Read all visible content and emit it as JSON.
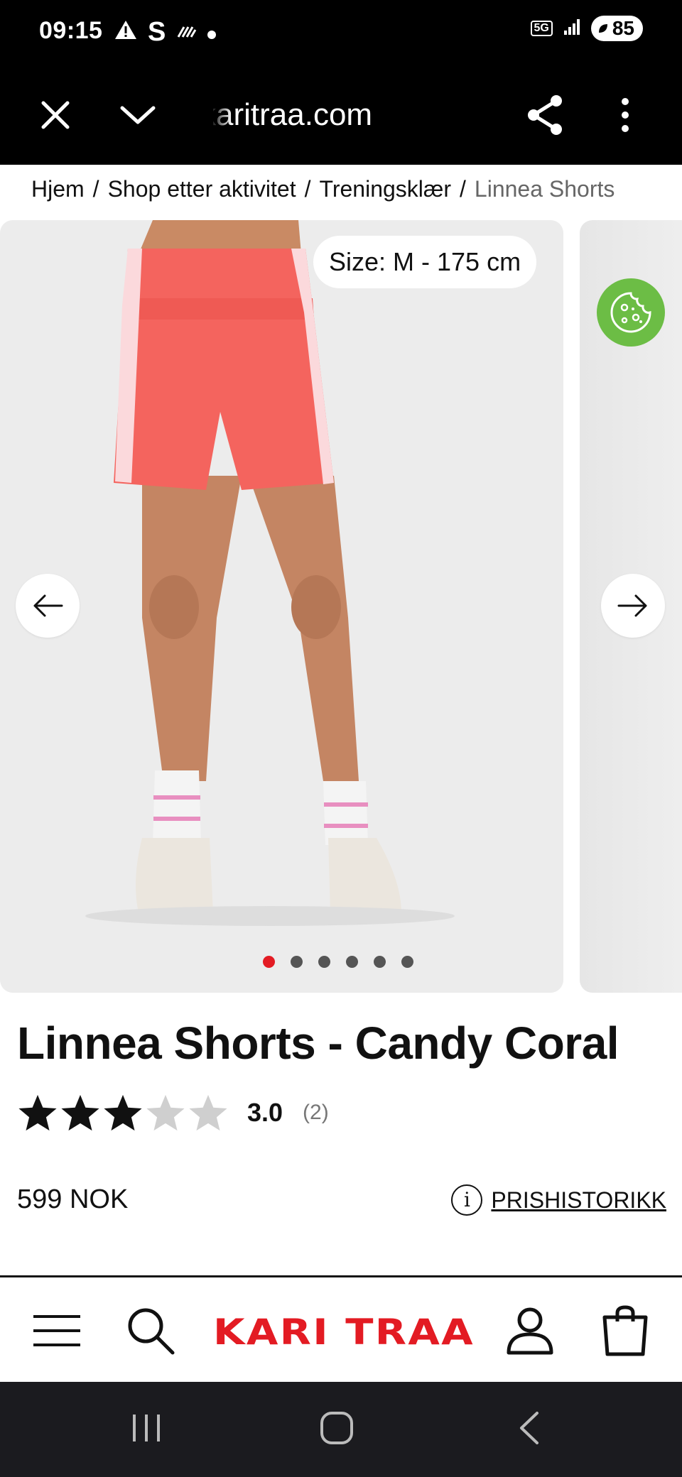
{
  "status_bar": {
    "time": "09:15",
    "left_icons": [
      "warning-icon",
      "s-icon",
      "signal-strength-icon",
      "dot-icon"
    ],
    "network": "5G",
    "battery": "85"
  },
  "browser": {
    "url": "karitraa.com",
    "close_icon": "close-icon",
    "dropdown_icon": "chevron-down-icon",
    "share_icon": "share-icon",
    "menu_icon": "more-vert-icon"
  },
  "breadcrumb": {
    "items": [
      "Hjem",
      "Shop etter aktivitet",
      "Treningsklær"
    ],
    "current": "Linnea Shorts",
    "separator": "/"
  },
  "gallery": {
    "size_tag": "Size: M - 175 cm",
    "slide_count": 6,
    "active_slide": 1
  },
  "product": {
    "title": "Linnea Shorts - Candy Coral",
    "rating_value": 3,
    "rating_max": 5,
    "rating_score": "3.0",
    "rating_count": "(2)",
    "price": "599 NOK",
    "price_history_label": "PRISHISTORIKK"
  },
  "bottom_nav": {
    "logo": "KARI TRAA",
    "items": [
      "menu-icon",
      "search-icon",
      "account-icon",
      "cart-icon"
    ]
  },
  "colors": {
    "brand_red": "#e31b23",
    "coral": "#f4645e",
    "cookie_green": "#6cbd45"
  }
}
